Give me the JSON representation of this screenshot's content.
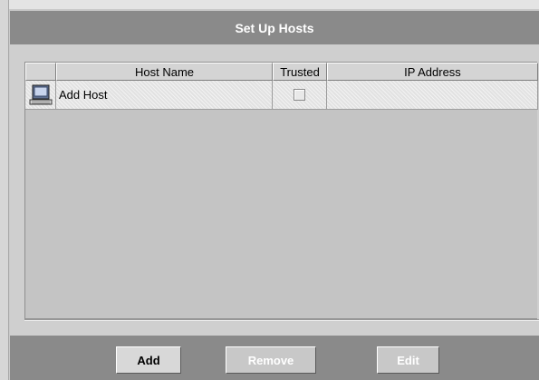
{
  "dialog": {
    "title": "Set Up Hosts"
  },
  "table": {
    "columns": [
      "",
      "Host Name",
      "Trusted",
      "IP Address"
    ],
    "rows": [
      {
        "icon": "computer-icon",
        "host_name": "Add Host",
        "trusted": false,
        "ip_address": ""
      }
    ]
  },
  "buttons": {
    "add": "Add",
    "remove": "Remove",
    "edit": "Edit"
  },
  "colors": {
    "title_bar": "#8a8a8a",
    "panel": "#cfcfcf",
    "disabled_text": "#ffffff"
  }
}
